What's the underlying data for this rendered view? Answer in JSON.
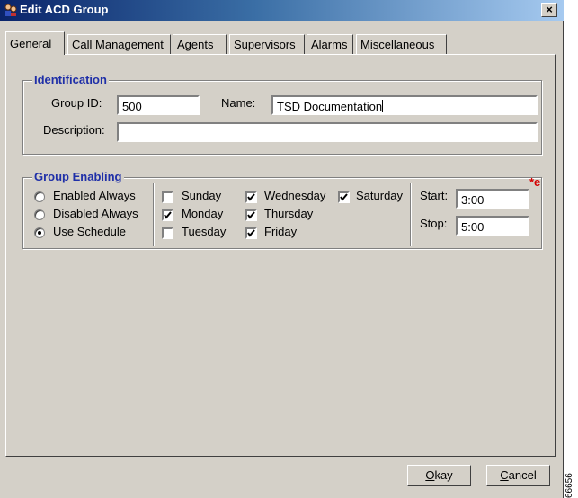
{
  "window": {
    "title": "Edit ACD Group",
    "close_label": "×"
  },
  "tabs": [
    {
      "label": "General",
      "active": true
    },
    {
      "label": "Call Management",
      "active": false
    },
    {
      "label": "Agents",
      "active": false
    },
    {
      "label": "Supervisors",
      "active": false
    },
    {
      "label": "Alarms",
      "active": false
    },
    {
      "label": "Miscellaneous",
      "active": false
    }
  ],
  "identification": {
    "legend": "Identification",
    "group_id_label": "Group ID:",
    "group_id_value": "500",
    "name_label": "Name:",
    "name_value": "TSD Documentation",
    "description_label": "Description:",
    "description_value": ""
  },
  "group_enabling": {
    "legend": "Group Enabling",
    "modes": [
      {
        "label": "Enabled Always",
        "selected": false
      },
      {
        "label": "Disabled Always",
        "selected": false
      },
      {
        "label": "Use Schedule",
        "selected": true
      }
    ],
    "days": [
      {
        "label": "Sunday",
        "checked": false
      },
      {
        "label": "Monday",
        "checked": true
      },
      {
        "label": "Tuesday",
        "checked": false
      },
      {
        "label": "Wednesday",
        "checked": true
      },
      {
        "label": "Thursday",
        "checked": true
      },
      {
        "label": "Friday",
        "checked": true
      },
      {
        "label": "Saturday",
        "checked": true
      }
    ],
    "start_label": "Start:",
    "start_value": "3:00",
    "stop_label": "Stop:",
    "stop_value": "5:00",
    "required_marker": "*e"
  },
  "buttons": {
    "okay_label": "kay",
    "okay_mnemonic": "O",
    "cancel_label": "ancel",
    "cancel_mnemonic": "C"
  },
  "figure_code": "66656"
}
